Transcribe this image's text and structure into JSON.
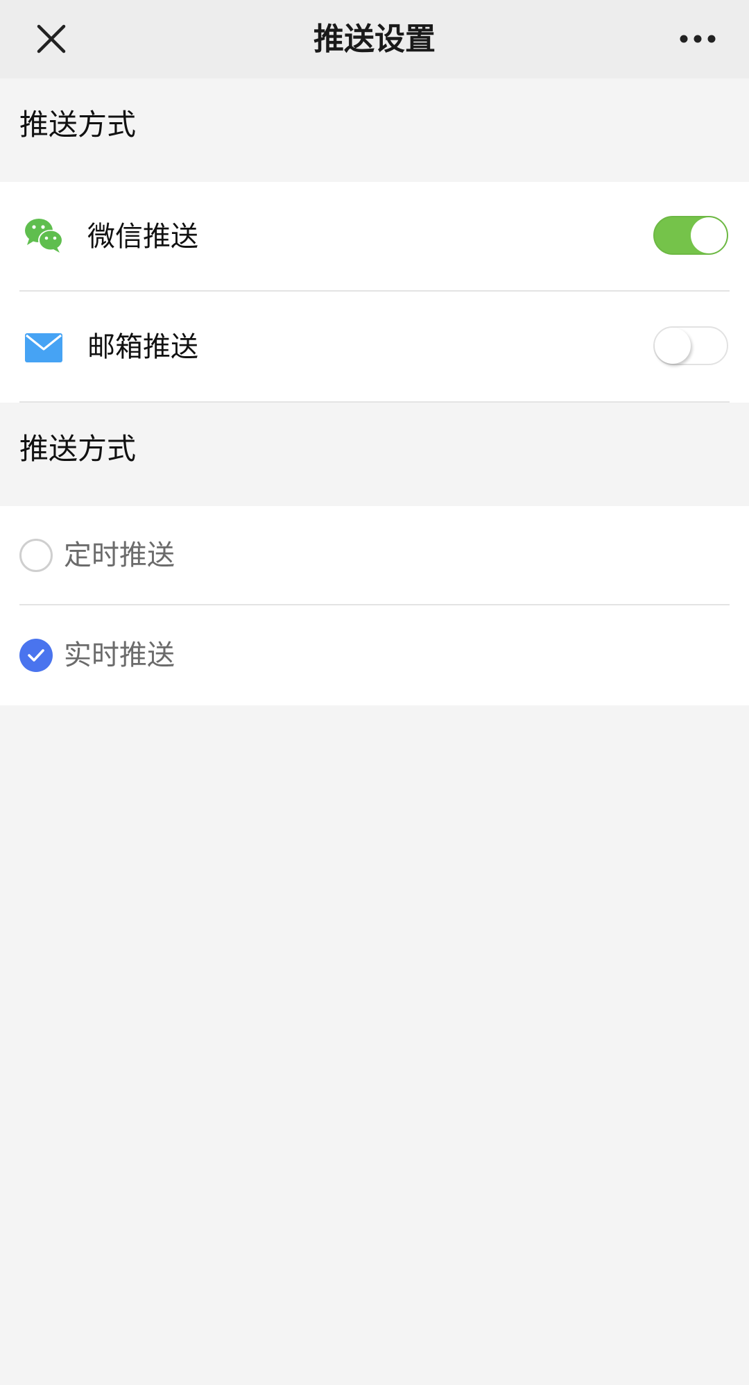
{
  "nav": {
    "title": "推送设置",
    "close_icon": "close-icon",
    "more_icon": "more-icon"
  },
  "sections": {
    "channel_header": "推送方式",
    "mode_header": "推送方式"
  },
  "channels": [
    {
      "label": "微信推送",
      "icon": "wechat-icon",
      "enabled": true
    },
    {
      "label": "邮箱推送",
      "icon": "mail-icon",
      "enabled": false
    }
  ],
  "modes": [
    {
      "label": "定时推送",
      "selected": false
    },
    {
      "label": "实时推送",
      "selected": true
    }
  ],
  "colors": {
    "switch_on": "#75c34a",
    "radio_selected": "#4a74ee",
    "wechat_green": "#5fbe4e",
    "mail_blue": "#46a3f4"
  }
}
